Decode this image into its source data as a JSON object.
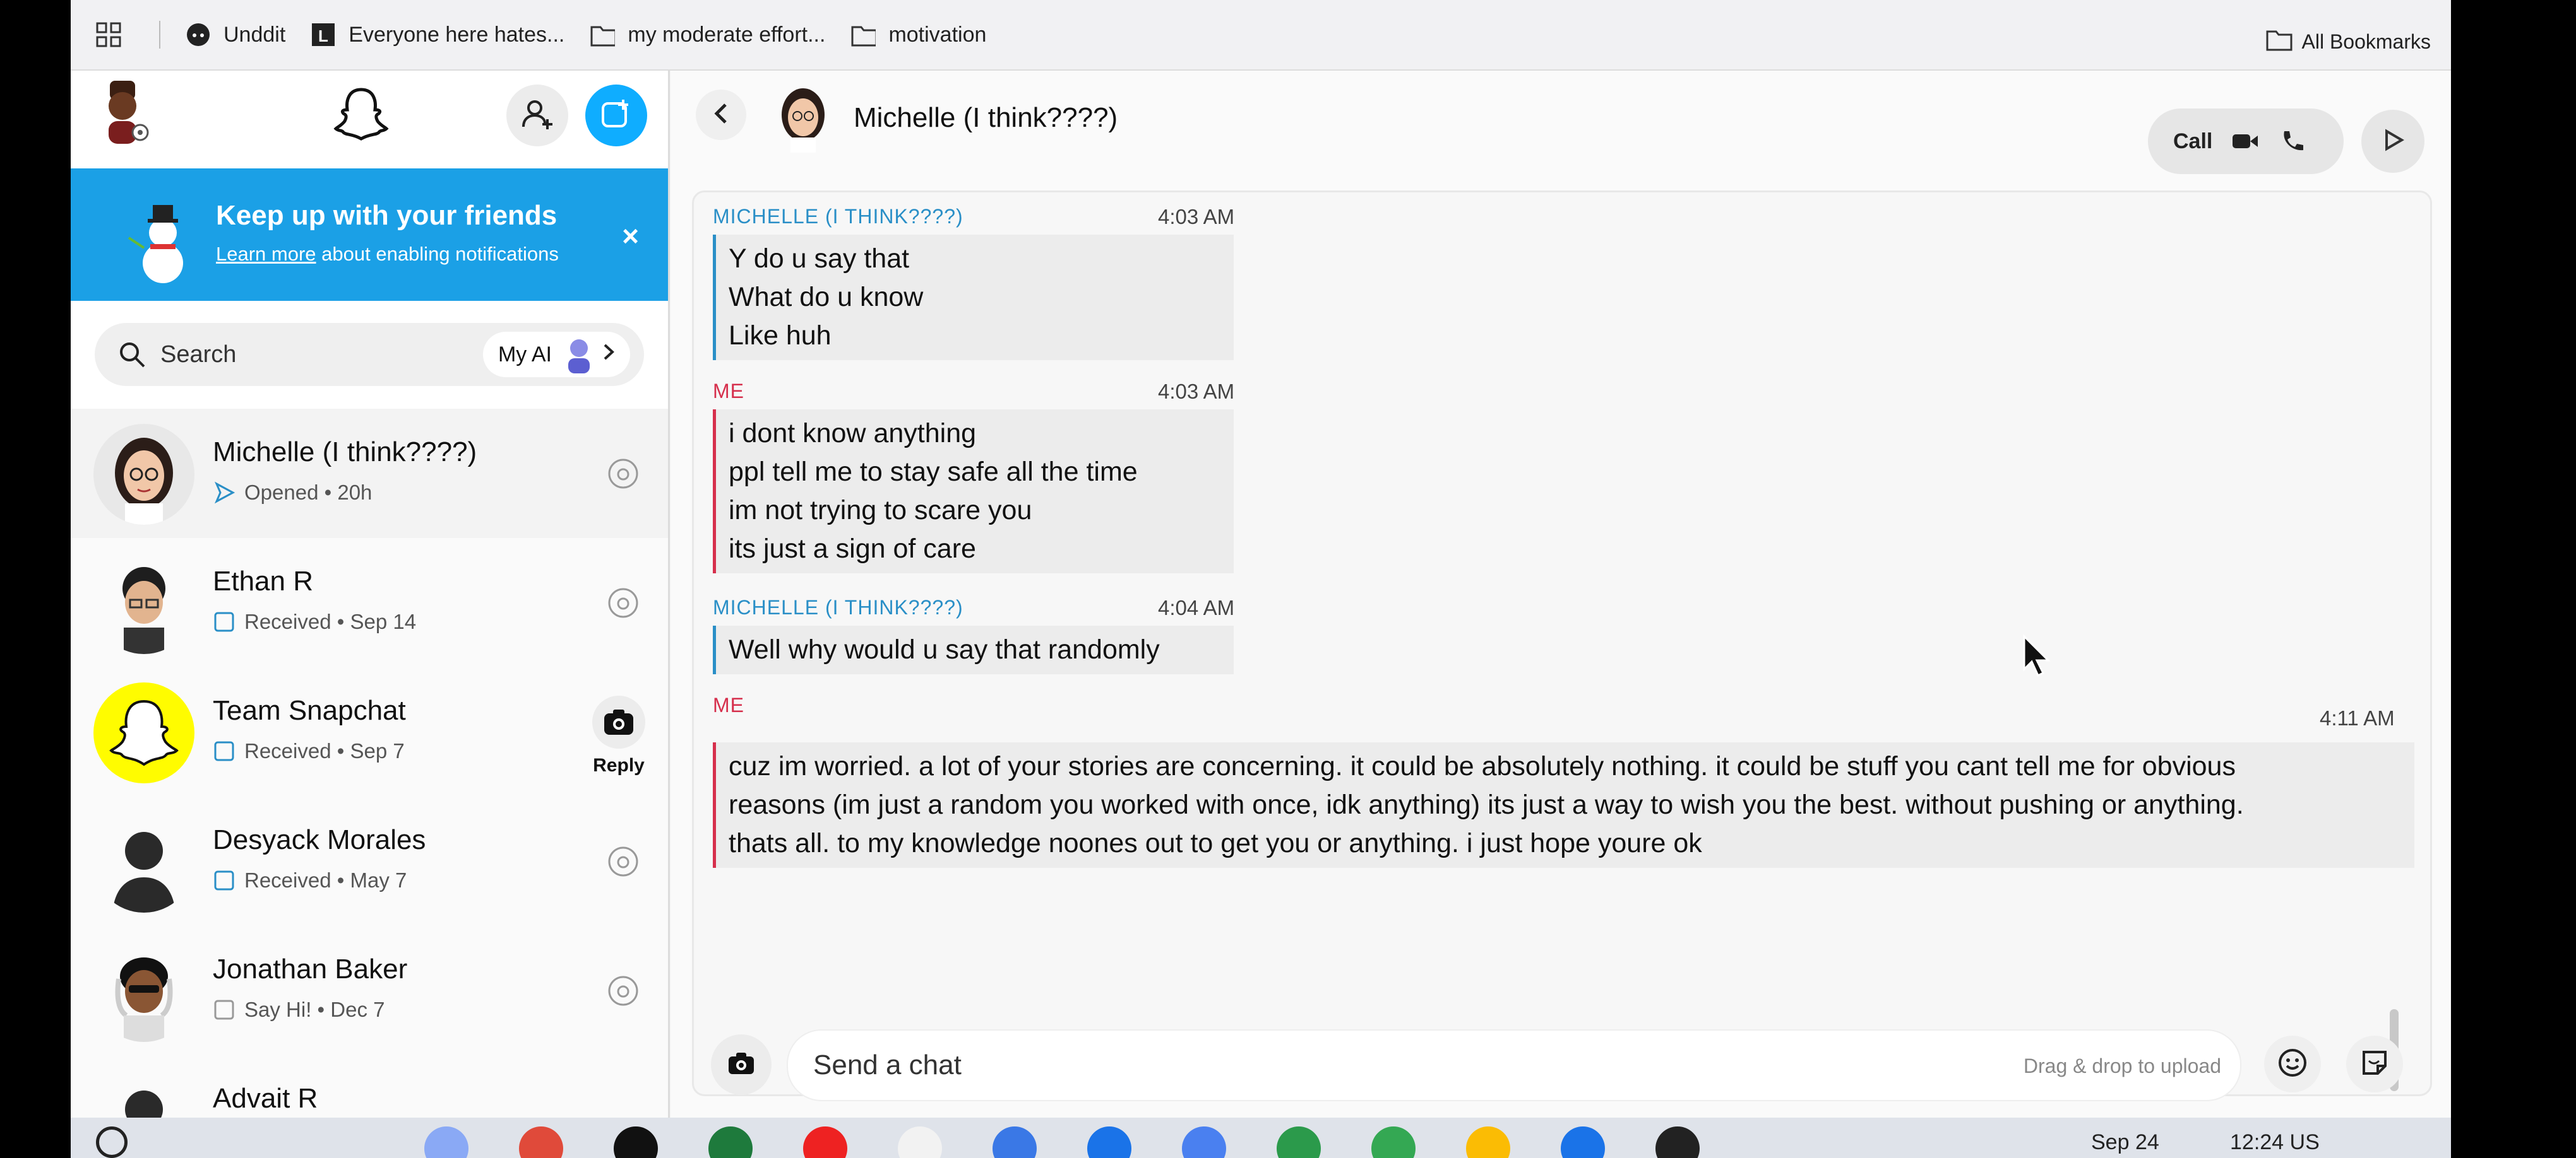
{
  "bookmarks": {
    "items": [
      {
        "label": "Unddit",
        "icon": "reddit-icon"
      },
      {
        "label": "Everyone here hates...",
        "icon": "letter-l-icon"
      },
      {
        "label": "my moderate effort...",
        "icon": "folder-icon"
      },
      {
        "label": "motivation",
        "icon": "folder-icon"
      }
    ],
    "all_bookmarks": "All Bookmarks"
  },
  "sidebar": {
    "notification": {
      "title": "Keep up with your friends",
      "learn_more": "Learn more",
      "rest": " about enabling notifications",
      "close": "×"
    },
    "search": {
      "placeholder": "Search",
      "my_ai": "My AI"
    },
    "chats": [
      {
        "name": "Michelle (I think????)",
        "status": "Opened",
        "time": "20h",
        "status_icon": "sent-arrow-icon"
      },
      {
        "name": "Ethan R",
        "status": "Received",
        "time": "Sep 14",
        "status_icon": "chat-icon"
      },
      {
        "name": "Team Snapchat",
        "status": "Received",
        "time": "Sep 7",
        "status_icon": "chat-icon",
        "action": "Reply"
      },
      {
        "name": "Desyack Morales",
        "status": "Received",
        "time": "May 7",
        "status_icon": "chat-icon"
      },
      {
        "name": "Jonathan Baker",
        "status": "Say Hi!",
        "time": "Dec 7",
        "status_icon": "chat-icon"
      },
      {
        "name": "Advait R",
        "status": "",
        "time": "",
        "status_icon": ""
      }
    ],
    "separator": "•"
  },
  "chat": {
    "title": "Michelle (I think????)",
    "call_label": "Call",
    "messages": [
      {
        "sender": "MICHELLE (I THINK????)",
        "from": "her",
        "time": "4:03 AM",
        "lines": [
          "Y do u say that",
          "What do u know",
          "Like huh"
        ]
      },
      {
        "sender": "ME",
        "from": "me",
        "time": "4:03 AM",
        "lines": [
          "i dont know anything",
          "ppl tell me to stay safe all the time",
          "im not trying to scare you",
          "its just a sign of care"
        ]
      },
      {
        "sender": "MICHELLE (I THINK????)",
        "from": "her",
        "time": "4:04 AM",
        "lines": [
          "Well why would u say that randomly"
        ]
      },
      {
        "sender": "ME",
        "from": "me",
        "time": "4:11 AM",
        "lines": [
          "cuz im worried. a lot of your stories are concerning. it could be absolutely nothing. it could be stuff you cant tell me for obvious",
          "reasons (im just a random you worked with once, idk anything) its just a way to wish you the best. without pushing or anything.",
          "thats all. to my knowledge noones out to get you or anything. i just hope youre ok"
        ]
      }
    ],
    "compose": {
      "placeholder": "Send a chat",
      "drag_drop": "Drag & drop to upload"
    }
  },
  "taskbar": {
    "date": "Sep 24",
    "time": "12:24 US"
  },
  "colors": {
    "notification_bg": "#1ba0e6",
    "her_accent": "#2a8fc7",
    "me_accent": "#d62f4c",
    "new_chat": "#0fadff",
    "team_snapchat": "#fffc00"
  }
}
